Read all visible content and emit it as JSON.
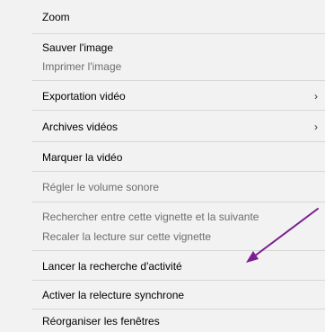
{
  "menu": {
    "zoom": "Zoom",
    "save_image": "Sauver l'image",
    "print_image": "Imprimer l'image",
    "video_export": "Exportation vidéo",
    "video_archives": "Archives vidéos",
    "mark_video": "Marquer la vidéo",
    "adjust_volume": "Régler le volume sonore",
    "search_between": "Rechercher entre cette vignette et la suivante",
    "resync_playback": "Recaler la lecture sur cette vignette",
    "launch_activity_search": "Lancer la recherche d'activité",
    "enable_sync_replay": "Activer la relecture synchrone",
    "reorganize_windows": "Réorganiser les fenêtres",
    "submenu_glyph": "›"
  },
  "colors": {
    "menu_background": "#f2f2f2",
    "separator": "#d7d7d7",
    "disabled_text": "#6d6d6d",
    "annotation_arrow": "#7a1f8f"
  }
}
